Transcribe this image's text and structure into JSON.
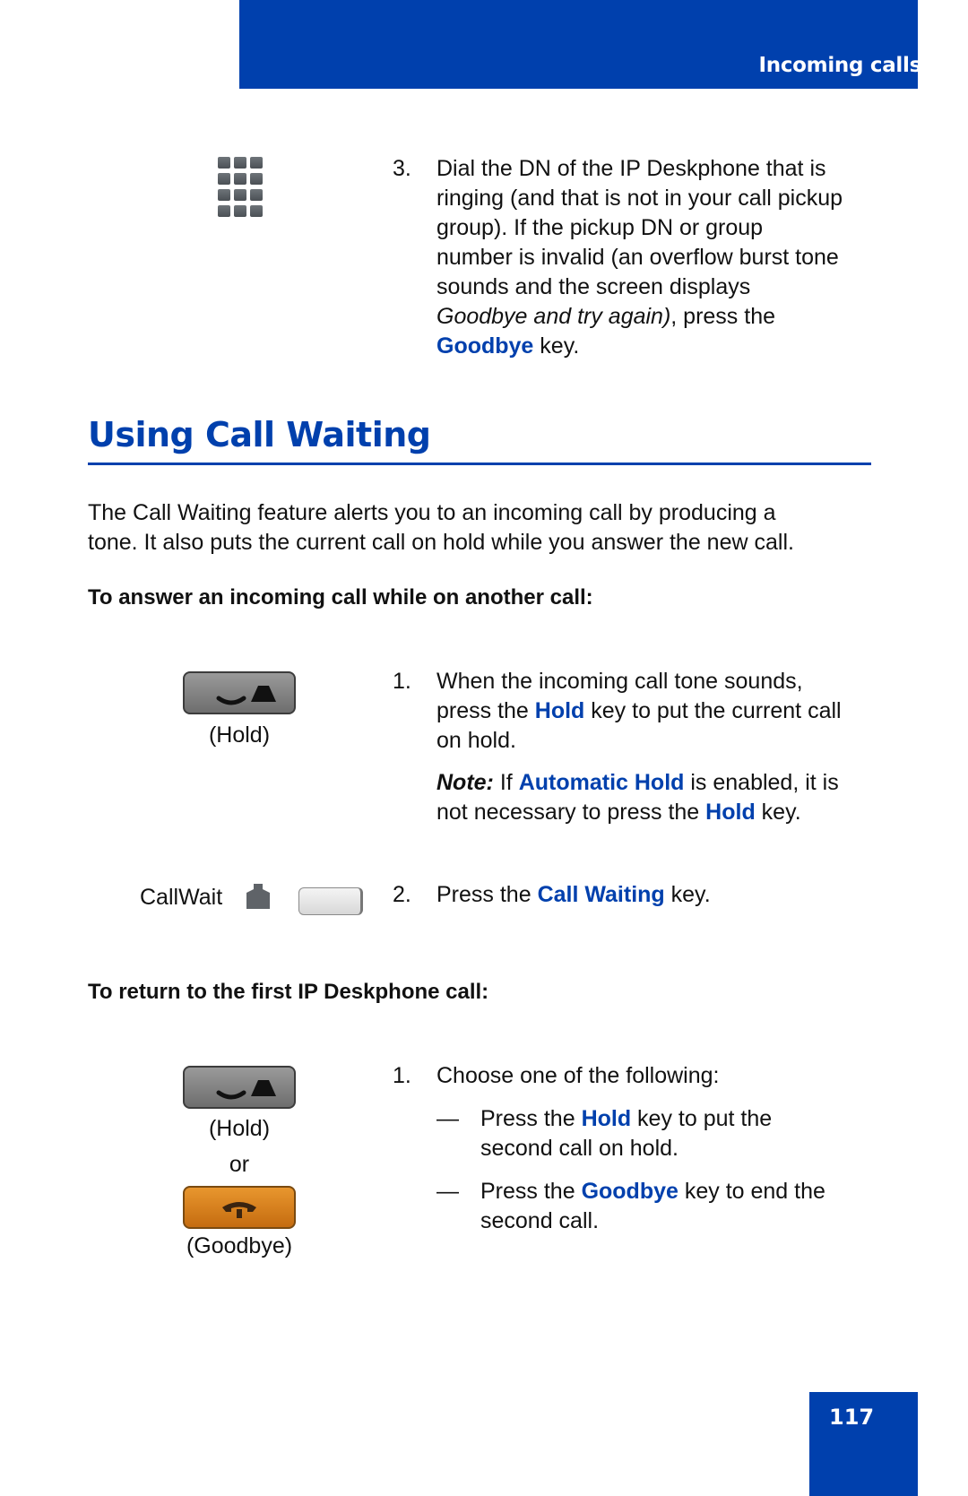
{
  "header": {
    "section_title": "Incoming calls"
  },
  "step_prev": {
    "number": "3.",
    "lines": [
      "Dial the DN of the IP Deskphone that is",
      "ringing (and that is not in your call pickup",
      "group). If the pickup DN or group",
      "number is invalid (an overflow burst tone",
      "sounds and the screen displays"
    ],
    "italic": "Goodbye and try again)",
    "after_italic": ", press the",
    "key_name": "Goodbye",
    "key_suffix": " key.",
    "icon": "dialpad-icon"
  },
  "section": {
    "title": "Using Call Waiting",
    "intro_lines": [
      "The Call Waiting feature alerts you to an incoming call by producing a",
      "tone. It also puts the current call on hold while you answer the new call."
    ]
  },
  "answer": {
    "subheading": "To answer an incoming call while on another call:",
    "hold_caption": "(Hold)",
    "step1": {
      "number": "1.",
      "line1": "When the incoming call tone sounds,",
      "line2_pre": "press the ",
      "line2_key": "Hold",
      "line2_post": " key to put the current call",
      "line3": "on hold."
    },
    "note": {
      "label": "Note:",
      "pre": " If ",
      "key1": "Automatic Hold",
      "mid": " is enabled, it is",
      "line2_pre": "not necessary to press the ",
      "key2": "Hold",
      "line2_post": " key."
    },
    "callwait_label": "CallWait",
    "step2": {
      "number": "2.",
      "pre": "Press the ",
      "key": "Call Waiting",
      "post": " key."
    }
  },
  "return": {
    "subheading": "To return to the first IP Deskphone call:",
    "hold_caption": "(Hold)",
    "or": "or",
    "goodbye_caption": "(Goodbye)",
    "step1": {
      "number": "1.",
      "text": "Choose one of the following:"
    },
    "options": [
      {
        "dash": "—",
        "pre": "Press the ",
        "key": "Hold",
        "post": " key to put the",
        "line2": "second call on hold."
      },
      {
        "dash": "—",
        "pre": "Press the ",
        "key": "Goodbye",
        "post": " key to end the",
        "line2": "second call."
      }
    ]
  },
  "footer": {
    "page_number": "117"
  },
  "colors": {
    "brand_blue": "#0040ad",
    "goodbye_orange": "#d97f1f",
    "hold_gray": "#7a7a7a"
  }
}
